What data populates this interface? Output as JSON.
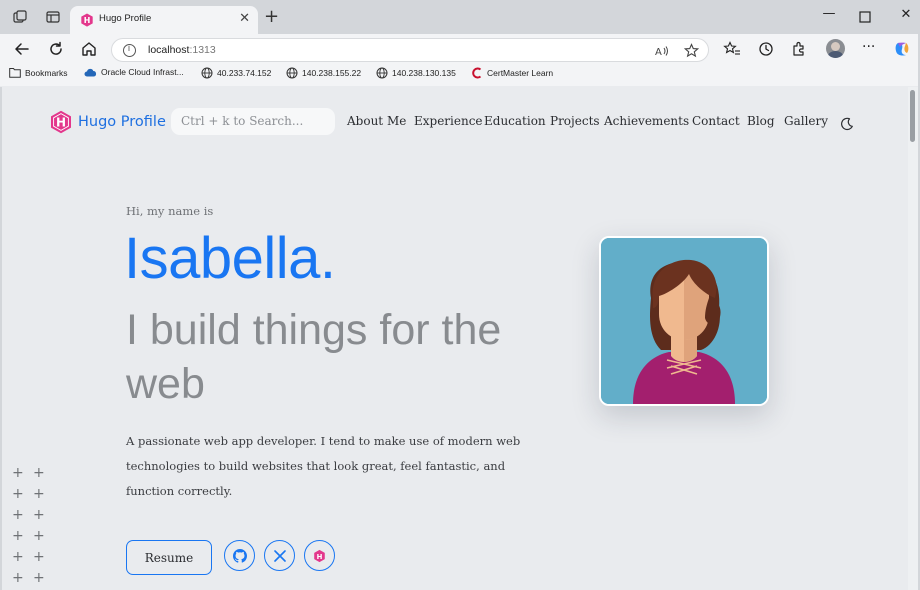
{
  "browser": {
    "tab_title": "Hugo Profile",
    "url_host": "localhost",
    "url_port": ":1313",
    "bookmarks": [
      {
        "label": "Bookmarks",
        "icon": "folder-icon"
      },
      {
        "label": "Oracle Cloud Infrast...",
        "icon": "cloud-icon"
      },
      {
        "label": "40.233.74.152",
        "icon": "globe-icon"
      },
      {
        "label": "140.238.155.22",
        "icon": "globe-icon"
      },
      {
        "label": "140.238.130.135",
        "icon": "globe-icon"
      },
      {
        "label": "CertMaster Learn",
        "icon": "certmaster-icon"
      }
    ]
  },
  "site": {
    "logo_text": "Hugo Profile",
    "search_placeholder": "Ctrl + k to Search...",
    "nav": [
      "About Me",
      "Experience",
      "Education",
      "Projects",
      "Achievements",
      "Contact",
      "Blog",
      "Gallery"
    ]
  },
  "hero": {
    "greeting": "Hi, my name is",
    "name": "Isabella.",
    "tagline": "I build things for the web",
    "description": "A passionate web app developer. I tend to make use of modern web technologies to build websites that look great, feel fantastic, and function correctly.",
    "resume_label": "Resume",
    "socials": [
      "github-icon",
      "x-icon",
      "hugo-icon"
    ]
  },
  "colors": {
    "accent": "#1976f2",
    "hugo_pink": "#e3378c",
    "avatar_bg": "#62aec9"
  }
}
